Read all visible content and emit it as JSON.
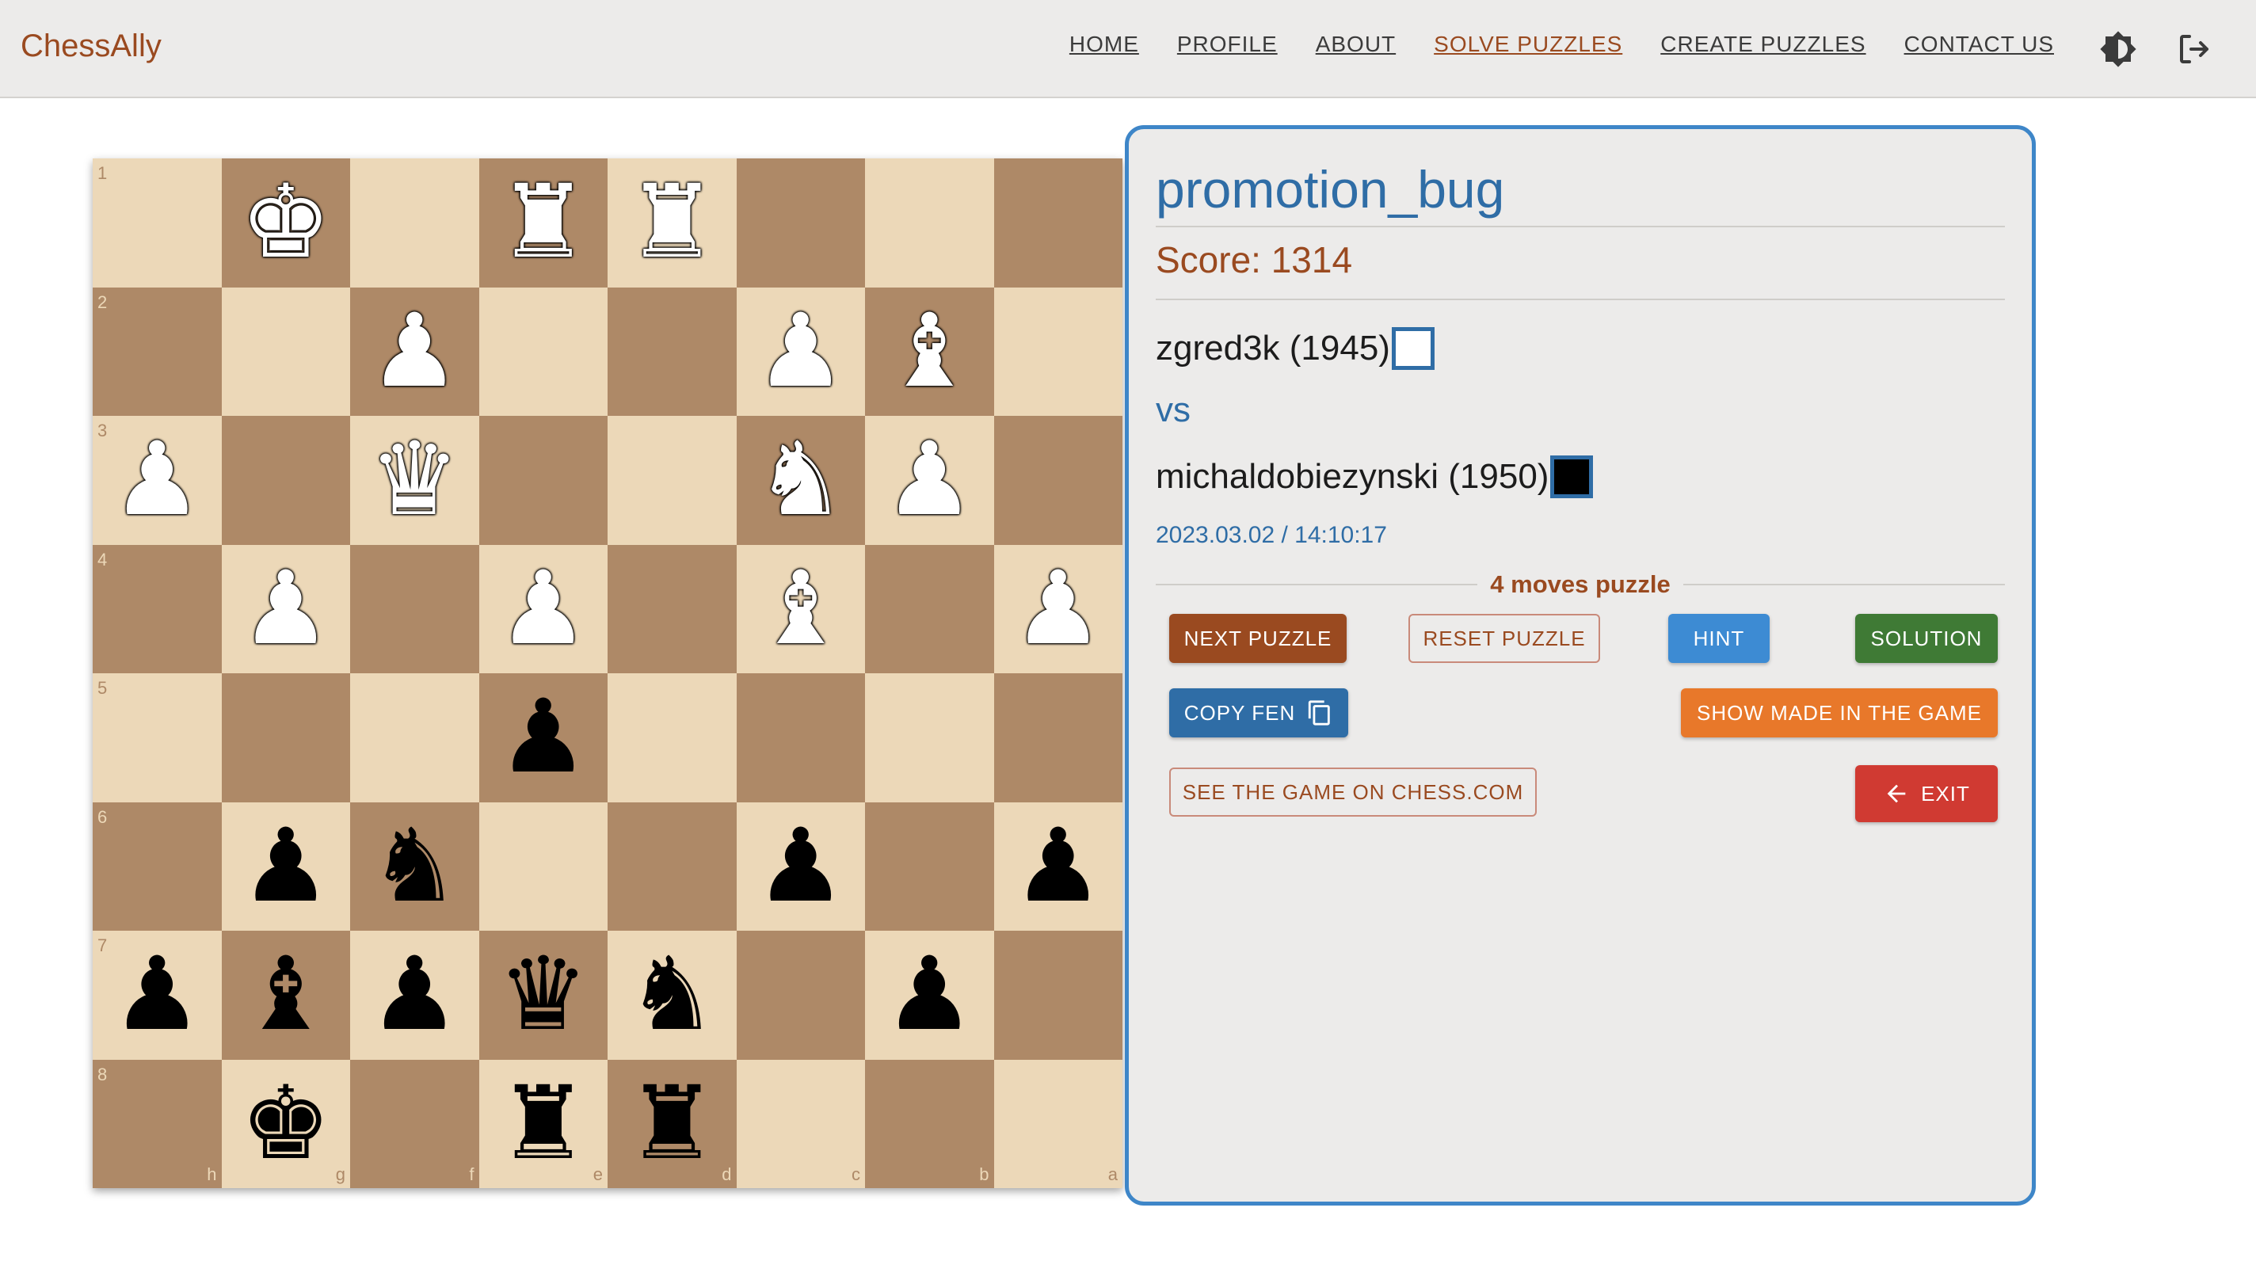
{
  "nav": {
    "brand": "ChessAlly",
    "links": [
      "HOME",
      "PROFILE",
      "ABOUT",
      "SOLVE PUZZLES",
      "CREATE PUZZLES",
      "CONTACT US"
    ],
    "active_index": 3,
    "icons": [
      "theme-toggle-icon",
      "logout-icon"
    ]
  },
  "board": {
    "ranks": [
      "1",
      "2",
      "3",
      "4",
      "5",
      "6",
      "7",
      "8"
    ],
    "files": [
      "h",
      "g",
      "f",
      "e",
      "d",
      "c",
      "b",
      "a"
    ],
    "rows": [
      [
        "",
        "wK",
        "",
        "wR",
        "wR",
        "",
        "",
        ""
      ],
      [
        "",
        "",
        "wP",
        "",
        "",
        "wP",
        "wB",
        ""
      ],
      [
        "wP",
        "",
        "wQ",
        "",
        "",
        "wN",
        "wP",
        ""
      ],
      [
        "",
        "wP",
        "",
        "wP",
        "",
        "wB",
        "",
        "wP"
      ],
      [
        "",
        "",
        "",
        "bP",
        "",
        "",
        "",
        ""
      ],
      [
        "",
        "bP",
        "bN",
        "",
        "",
        "bP",
        "",
        "bP"
      ],
      [
        "bP",
        "bB",
        "bP",
        "bQ",
        "bN",
        "",
        "bP",
        ""
      ],
      [
        "",
        "bK",
        "",
        "bR",
        "bR",
        "",
        "",
        ""
      ]
    ]
  },
  "puzzle": {
    "title": "promotion_bug",
    "score_label": "Score: 1314",
    "white_player": "zgred3k (1945)",
    "vs": "vs",
    "black_player": "michaldobiezynski (1950)",
    "datetime": "2023.03.02 / 14:10:17",
    "moves_label": "4 moves puzzle"
  },
  "buttons": {
    "next": "NEXT PUZZLE",
    "reset": "RESET PUZZLE",
    "hint": "HINT",
    "solution": "SOLUTION",
    "copy_fen": "COPY FEN",
    "show_made": "SHOW MADE IN THE GAME",
    "see_game": "SEE THE GAME ON CHESS.COM",
    "exit": "EXIT"
  },
  "colors": {
    "brand": "#9a4a20",
    "accent_blue": "#2f6da6",
    "board_light": "#ecd8b8",
    "board_dark": "#ae8967",
    "btn_next": "#9a4a20",
    "btn_reset_border": "#c98a7a",
    "btn_hint": "#3d8bd3",
    "btn_solution": "#3f7a35",
    "btn_copy": "#2f6da6",
    "btn_show": "#e8782a",
    "btn_exit": "#d03a32",
    "panel_border": "#3e86c8"
  }
}
